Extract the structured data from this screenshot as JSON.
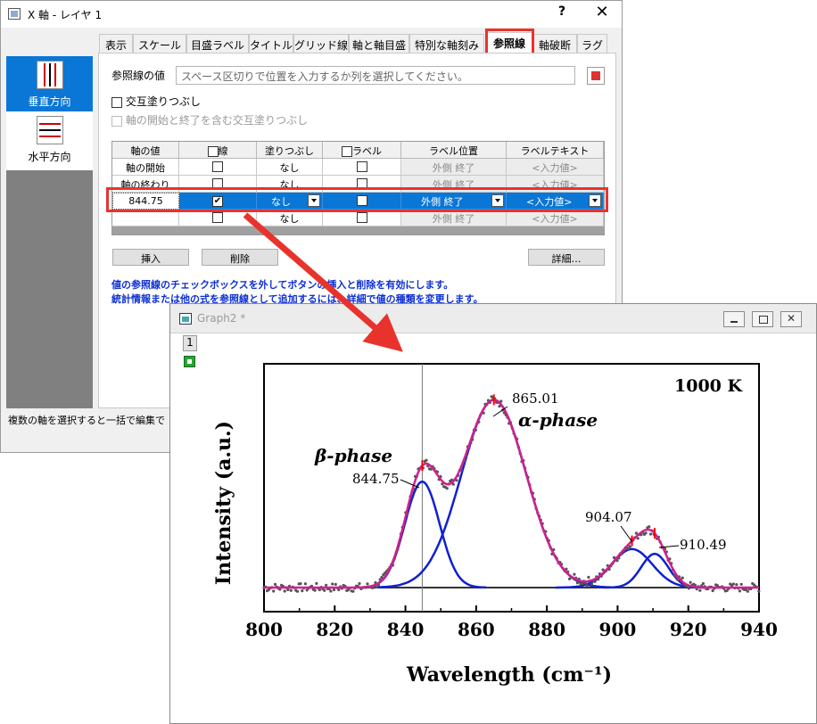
{
  "dialog": {
    "title": "X 軸 - レイヤ 1",
    "help": "?",
    "close": "✕",
    "tabs": [
      "表示",
      "スケール",
      "目盛ラベル",
      "タイトル",
      "グリッド線",
      "軸と軸目盛",
      "特別な軸刻み",
      "参照線",
      "軸破断",
      "ラグ"
    ],
    "active_tab": "参照線",
    "side_items": [
      "垂直方向",
      "水平方向"
    ],
    "ref_label": "参照線の値",
    "ref_placeholder": "スペース区切りで位置を入力するか列を選択してください。",
    "alt_fill": "交互塗りつぶし",
    "alt_fill_incl": "軸の開始と終了を含む交互塗りつぶし",
    "grid": {
      "headers": [
        "軸の値",
        "線",
        "塗りつぶし",
        "ラベル",
        "ラベル位置",
        "ラベルテキスト"
      ],
      "rows": [
        {
          "value": "軸の開始",
          "line": false,
          "fill": "なし",
          "label": false,
          "pos": "外側 終了",
          "text": "<入力値>"
        },
        {
          "value": "軸の終わり",
          "line": false,
          "fill": "なし",
          "label": false,
          "pos": "外側 終了",
          "text": "<入力値>"
        },
        {
          "value": "844.75",
          "line": true,
          "fill": "なし",
          "label": false,
          "pos": "外側 終了",
          "text": "<入力値>"
        },
        {
          "value": "",
          "line": false,
          "fill": "なし",
          "label": false,
          "pos": "外側 終了",
          "text": "<入力値>"
        }
      ]
    },
    "buttons": {
      "insert": "挿入",
      "delete": "削除",
      "detail": "詳細…"
    },
    "info_line1": "値の参照線のチェックボックスを外してボタンの挿入と削除を有効にします。",
    "info_line2": "統計情報または他の式を参照線として追加するには、詳細で値の種類を変更します。",
    "status": "複数の軸を選択すると一括で編集で"
  },
  "graph": {
    "title": "Graph2 *",
    "layer": "1",
    "colors": {
      "data": "#555555",
      "fit": "#d02090",
      "peak": "#1020d0",
      "baseline": "#333333",
      "refline": "#777777",
      "marker": "#ff0000"
    },
    "annotations": {
      "temp": "1000 K",
      "alpha": "α-phase",
      "beta": "β-phase",
      "p1": "865.01",
      "p2": "844.75",
      "p3": "904.07",
      "p4": "910.49"
    }
  },
  "chart_data": {
    "type": "line",
    "title": "",
    "xlabel": "Wavelength (cm⁻¹)",
    "ylabel": "Intensity (a.u.)",
    "xlim": [
      800,
      940
    ],
    "xticks": [
      800,
      820,
      840,
      860,
      880,
      900,
      920,
      940
    ],
    "reference_line_x": 844.75,
    "peaks": [
      {
        "center": 844.75,
        "height": 0.44,
        "width": 11.5
      },
      {
        "center": 865.01,
        "height": 0.78,
        "width": 21.5
      },
      {
        "center": 904.07,
        "height": 0.16,
        "width": 13.5
      },
      {
        "center": 910.49,
        "height": 0.14,
        "width": 9.0
      }
    ],
    "markers": [
      844.75,
      865.01,
      904.07,
      910.49
    ],
    "series": [
      {
        "values_x": [
          800,
          820,
          830,
          835,
          840,
          845,
          850,
          855,
          860,
          865,
          870,
          875,
          880,
          885,
          890,
          895,
          900,
          905,
          910,
          915,
          920,
          930,
          940
        ]
      }
    ]
  }
}
